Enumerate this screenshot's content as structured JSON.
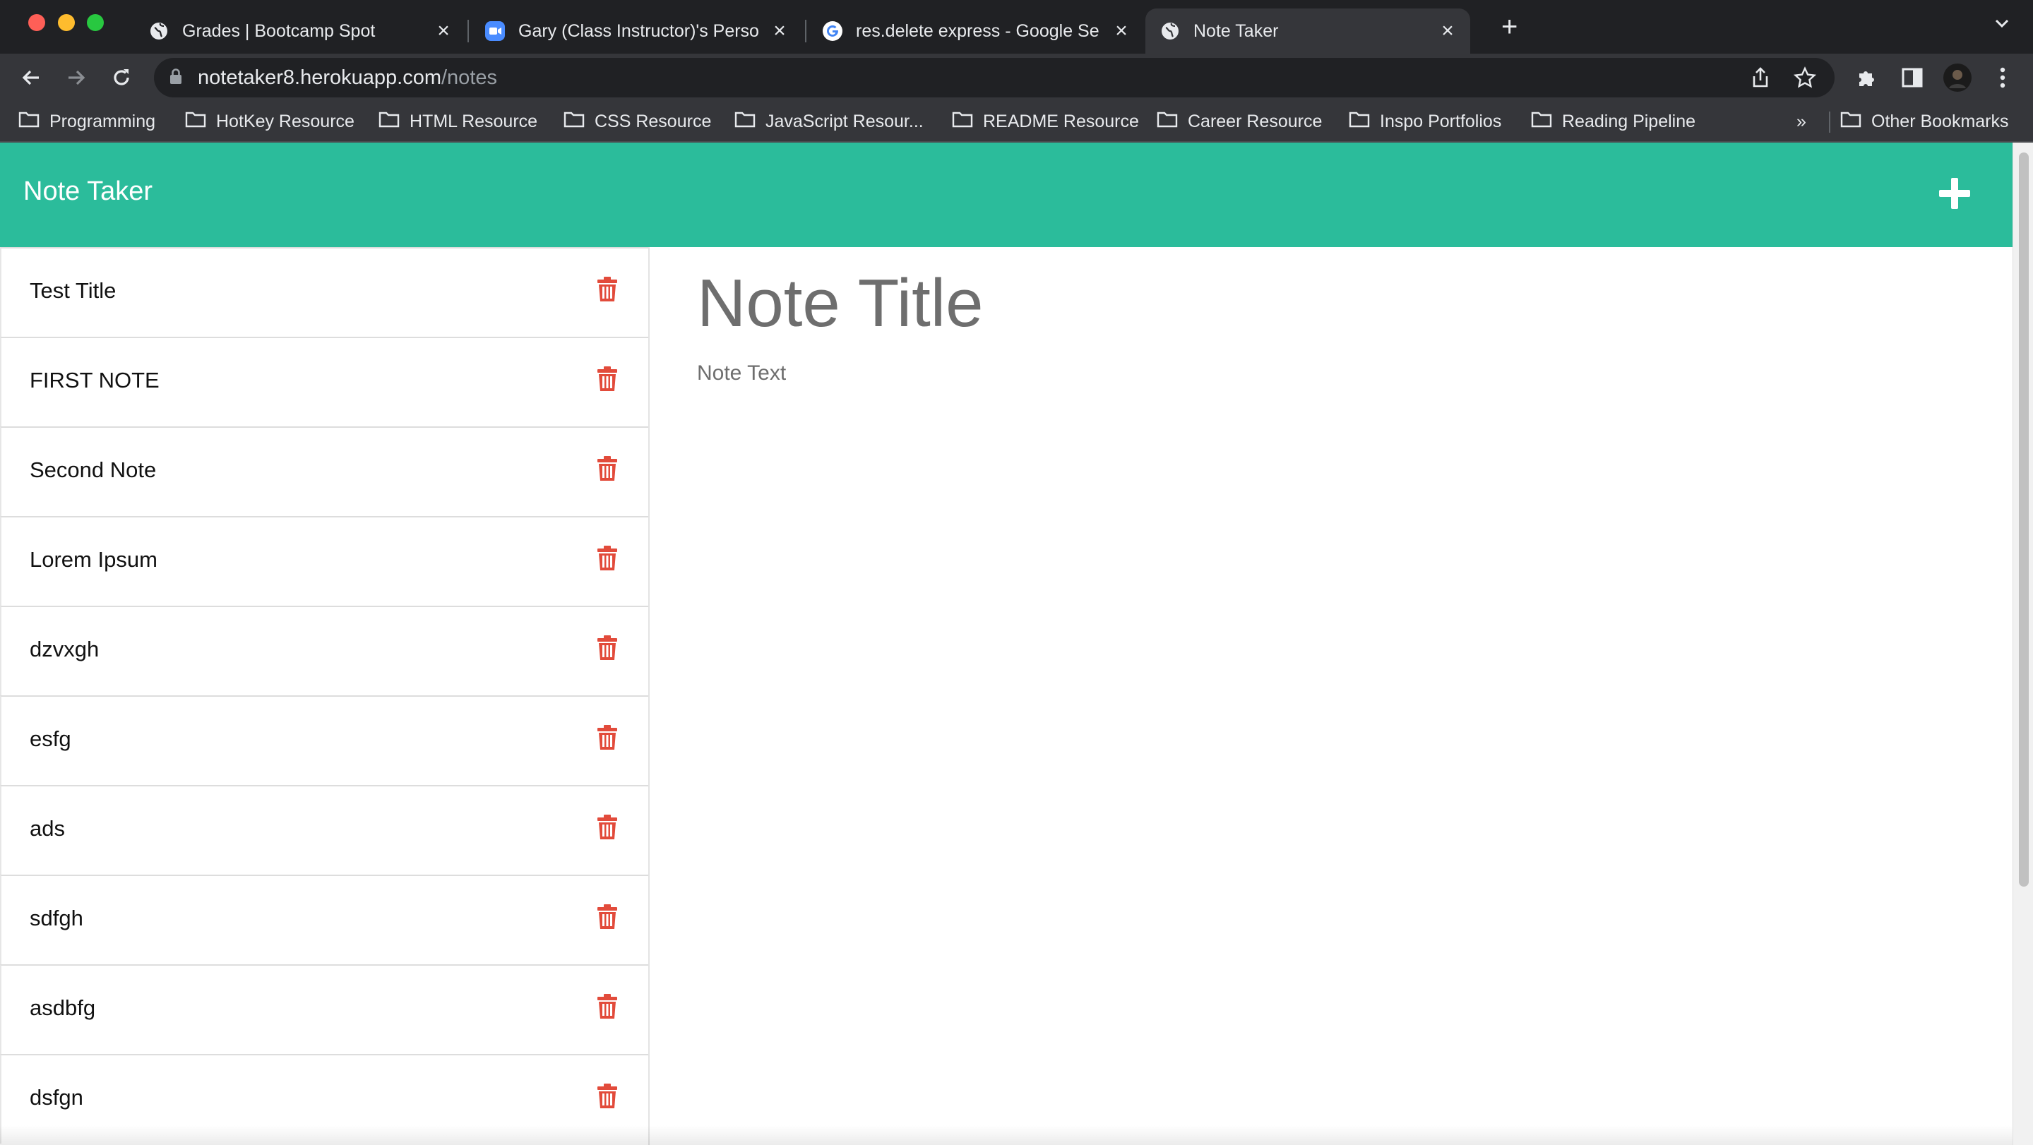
{
  "browser": {
    "tabs": [
      {
        "title": "Grades | Bootcamp Spot",
        "icon": "globe-icon"
      },
      {
        "title": "Gary (Class Instructor)'s Perso",
        "icon": "zoom-video-icon"
      },
      {
        "title": "res.delete express - Google Se",
        "icon": "google-icon"
      },
      {
        "title": "Note Taker",
        "icon": "globe-icon",
        "active": true
      }
    ],
    "url_host": "notetaker8.herokuapp.com",
    "url_path": "/notes",
    "bookmarks": [
      "Programming",
      "HotKey Resource",
      "HTML Resource",
      "CSS Resource",
      "JavaScript Resour...",
      "README Resource",
      "Career Resource",
      "Inspo Portfolios",
      "Reading Pipeline"
    ],
    "bookmarks_overflow": "»",
    "other_bookmarks": "Other Bookmarks"
  },
  "app": {
    "brand": "Note Taker",
    "accent_color": "#2bbc9b",
    "delete_color": "#e24b3b",
    "notes": [
      "Test Title",
      "FIRST NOTE",
      "Second Note",
      "Lorem Ipsum",
      "dzvxgh",
      "esfg",
      "ads",
      "sdfgh",
      "asdbfg",
      "dsfgn"
    ],
    "editor": {
      "title_placeholder": "Note Title",
      "text_placeholder": "Note Text"
    }
  }
}
